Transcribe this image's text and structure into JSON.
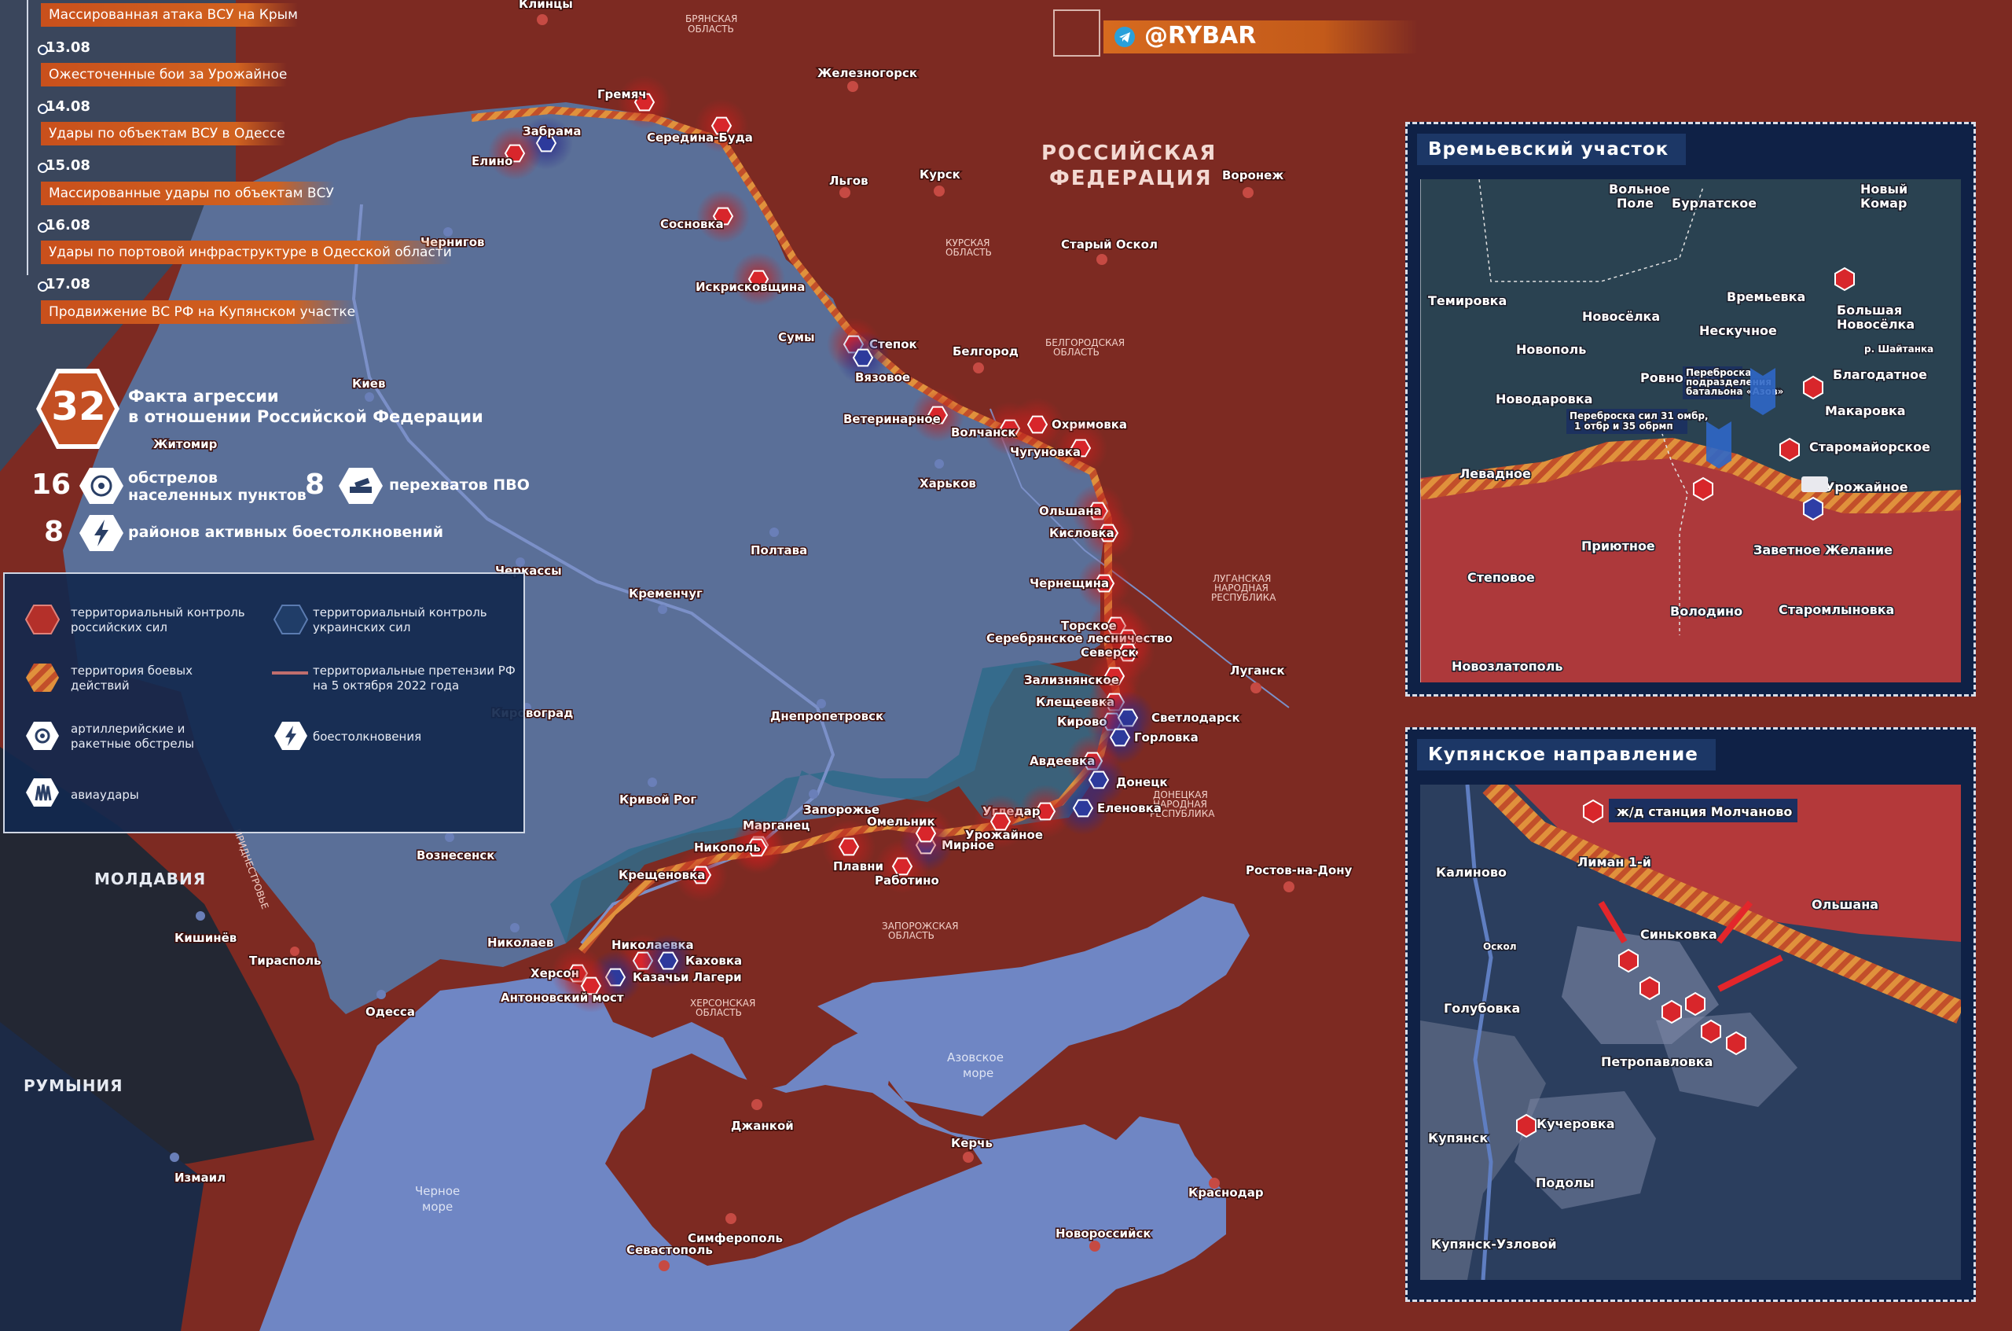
{
  "brand": {
    "handle": "@RYBAR"
  },
  "timeline": [
    {
      "date": "",
      "text": "Массированная атака ВСУ на Крым"
    },
    {
      "date": "13.08",
      "text": "Ожесточенные бои за Урожайное"
    },
    {
      "date": "14.08",
      "text": "Удары по объектам ВСУ в Одессе"
    },
    {
      "date": "15.08",
      "text": "Массированные удары по объектам ВСУ"
    },
    {
      "date": "16.08",
      "text": "Удары по портовой инфраструктуре в Одесской области"
    },
    {
      "date": "17.08",
      "text": "Продвижение ВС РФ на Купянском участке"
    }
  ],
  "stats": {
    "total_value": "32",
    "total_label_1": "Факта агрессии",
    "total_label_2": "в отношении Российской Федерации",
    "shelling_value": "16",
    "shelling_label_1": "обстрелов",
    "shelling_label_2": "населенных пунктов",
    "pvo_value": "8",
    "pvo_label": "перехватов ПВО",
    "clash_value": "8",
    "clash_label": "районов активных боестолкновений"
  },
  "legend": {
    "ru_control": "территориальный контроль российских сил",
    "ua_control": "территориальный контроль украинских сил",
    "combat": "территория боевых действий",
    "claims": "территориальные претензии РФ на 5 октября 2022 года",
    "artillery": "артиллерийские и ракетные обстрелы",
    "clashes": "боестолкновения",
    "airstrikes": "авиаудары"
  },
  "map_labels": {
    "russia_1": "РОССИЙСКАЯ",
    "russia_2": "ФЕДЕРАЦИЯ",
    "moldova": "МОЛДАВИЯ",
    "romania": "РУМЫНИЯ",
    "pridnestrovie": "ПРИДНЕСТРОВЬЕ",
    "black_sea_1": "Черное",
    "black_sea_2": "море",
    "azov_sea_1": "Азовское",
    "azov_sea_2": "море",
    "bryansk_reg_1": "БРЯНСКАЯ",
    "bryansk_reg_2": "ОБЛАСТЬ",
    "kursk_reg_1": "КУРСКАЯ",
    "kursk_reg_2": "ОБЛАСТЬ",
    "belgorod_reg_1": "БЕЛГОРОДСКАЯ",
    "belgorod_reg_2": "ОБЛАСТЬ",
    "lugansk_reg_1": "ЛУГАНСКАЯ",
    "lugansk_reg_2": "НАРОДНАЯ",
    "lugansk_reg_3": "РЕСПУБЛИКА",
    "donetsk_reg_1": "ДОНЕЦКАЯ",
    "donetsk_reg_2": "НАРОДНАЯ",
    "donetsk_reg_3": "РЕСПУБЛИКА",
    "zaporozhye_reg_1": "ЗАПОРОЖСКАЯ",
    "zaporozhye_reg_2": "ОБЛАСТЬ",
    "kherson_reg_1": "ХЕРСОНСКАЯ",
    "kherson_reg_2": "ОБЛАСТЬ"
  },
  "cities": {
    "klincy": "Клинцы",
    "zheleznogorsk": "Железногорск",
    "kursk": "Курск",
    "lgov": "Льгов",
    "voronezh": "Воронеж",
    "stary_oskol": "Старый Оскол",
    "belgorod": "Белгород",
    "chernigov": "Чернигов",
    "sumy": "Сумы",
    "kiev": "Киев",
    "zhitomir": "Житомир",
    "kharkov": "Харьков",
    "poltava": "Полтава",
    "cherkassy": "Черкассы",
    "kremenchug": "Кременчуг",
    "kirovograd": "Кировоград",
    "dnepropetrovsk": "Днепропетровск",
    "krivoy_rog": "Кривой Рог",
    "zaporozhye": "Запорожье",
    "voznesensk": "Вознесенск",
    "nikolaev": "Николаев",
    "kishinev": "Кишинёв",
    "tiraspol": "Тирасполь",
    "odessa": "Одесса",
    "izmail": "Измаил",
    "lugansk": "Луганск",
    "rostov": "Ростов-на-Дону",
    "dzhankoy": "Джанкой",
    "kerch": "Керчь",
    "simferopol": "Симферополь",
    "sevastopol": "Севастополь",
    "krasnodar": "Краснодар",
    "novorossiysk": "Новороссийск"
  },
  "front_points": [
    {
      "name": "Забрама",
      "kind": "pvo"
    },
    {
      "name": "Гремяч",
      "kind": "shell"
    },
    {
      "name": "Елино",
      "kind": "shell"
    },
    {
      "name": "Середина-Буда",
      "kind": "shell"
    },
    {
      "name": "Сосновка",
      "kind": "shell"
    },
    {
      "name": "Искрисковщина",
      "kind": "shell"
    },
    {
      "name": "Степок",
      "kind": "shell"
    },
    {
      "name": "Вязовое",
      "kind": "pvo"
    },
    {
      "name": "Ветеринарное",
      "kind": "shell"
    },
    {
      "name": "Волчанск",
      "kind": "shell"
    },
    {
      "name": "Охримовка",
      "kind": "shell"
    },
    {
      "name": "Чугуновка",
      "kind": "shell"
    },
    {
      "name": "Ольшана",
      "kind": "clash"
    },
    {
      "name": "Кисловка",
      "kind": "shell"
    },
    {
      "name": "Чернещина",
      "kind": "air"
    },
    {
      "name": "Торское",
      "kind": "clash"
    },
    {
      "name": "Серебрянское лесничество",
      "kind": "clash"
    },
    {
      "name": "Северск",
      "kind": "air"
    },
    {
      "name": "Зализнянское",
      "kind": "clash"
    },
    {
      "name": "Клещеевка",
      "kind": "clash"
    },
    {
      "name": "Кирово",
      "kind": "shell"
    },
    {
      "name": "Светлодарск",
      "kind": "pvo"
    },
    {
      "name": "Горловка",
      "kind": "pvo"
    },
    {
      "name": "Авдеевка",
      "kind": "shell"
    },
    {
      "name": "Донецк",
      "kind": "pvo"
    },
    {
      "name": "Угледар",
      "kind": "shell"
    },
    {
      "name": "Еленовка",
      "kind": "pvo"
    },
    {
      "name": "Урожайное",
      "kind": "clash"
    },
    {
      "name": "Мирное",
      "kind": "pvo"
    },
    {
      "name": "Омельник",
      "kind": "shell"
    },
    {
      "name": "Работино",
      "kind": "clash"
    },
    {
      "name": "Плавни",
      "kind": "shell"
    },
    {
      "name": "Марганец",
      "kind": "shell"
    },
    {
      "name": "Никополь",
      "kind": "shell"
    },
    {
      "name": "Крещеновка",
      "kind": "shell"
    },
    {
      "name": "Николаевка",
      "kind": "shell"
    },
    {
      "name": "Каховка",
      "kind": "pvo"
    },
    {
      "name": "Казачьи Лагери",
      "kind": "pvo"
    },
    {
      "name": "Херсон",
      "kind": "shell"
    },
    {
      "name": "Антоновский мост",
      "kind": "clash"
    }
  ],
  "inset_vremevka": {
    "title": "Времьевский участок",
    "labels": {
      "volnoe_pole_1": "Вольное",
      "volnoe_pole_2": "Поле",
      "burlatskoe": "Бурлатское",
      "novy_komar_1": "Новый",
      "novy_komar_2": "Комар",
      "temirovka": "Темировка",
      "vremevka": "Времьевка",
      "novoselka": "Новосёлка",
      "bolshaya_novoselka_1": "Большая",
      "bolshaya_novoselka_2": "Новосёлка",
      "neskuchnoe": "Нескучное",
      "novopol": "Новополь",
      "shaytanka": "р. Шайтанка",
      "rovnopol": "Ровнополь",
      "azov_1": "Переброска",
      "azov_2": "подразделения",
      "azov_3": "батальона «Азов»",
      "blagodatnoe": "Благодатное",
      "novodarovka": "Новодаровка",
      "makarovka": "Макаровка",
      "transfer_1": "Переброска сил 31 омбр,",
      "transfer_2": "1 отбр и 35 обрмп",
      "staromayorskoe": "Старомайорское",
      "levadnoe": "Левадное",
      "urozhaynoe": "Урожайное",
      "priyutnoe": "Приютное",
      "zavetnoe": "Заветное Желание",
      "stepovoe": "Степовое",
      "volodino": "Володино",
      "staromlynovka": "Старомлыновка",
      "novozlatopol": "Новозлатополь"
    }
  },
  "inset_kupyansk": {
    "title": "Купянское направление",
    "labels": {
      "molchanovo": "ж/д станция Молчаново",
      "liman": "Лиман 1-й",
      "kalinovo": "Калиново",
      "olshana": "Ольшана",
      "oskol": "Оскол",
      "sinkovka": "Синьковка",
      "golubovka": "Голубовка",
      "petropavlovka": "Петропавловка",
      "kucherovka": "Кучеровка",
      "kupyansk": "Купянск",
      "podoly": "Подолы",
      "kupyansk_uzlovoy": "Купянск-Узловой"
    }
  },
  "colors": {
    "ru": "#8a2a22",
    "ua": "#4e6a9a",
    "combat": "#d46a2a",
    "sea": "#6f86c4",
    "accent": "#cf5a1c"
  }
}
